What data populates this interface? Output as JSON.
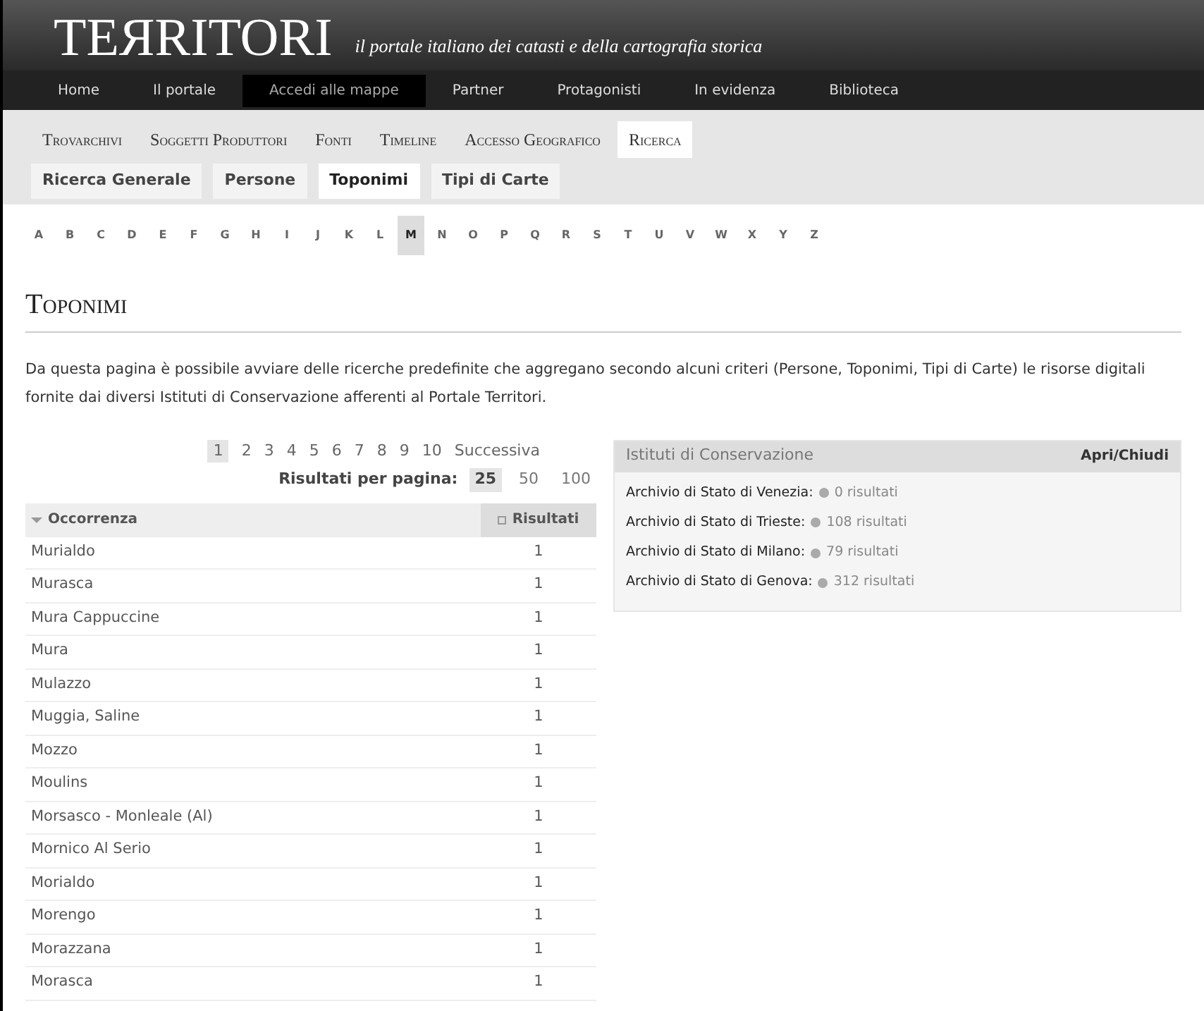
{
  "header": {
    "logo": "TEЯRITORI",
    "tagline": "il portale italiano dei catasti e della cartografia storica"
  },
  "main_nav": [
    {
      "label": "Home",
      "selected": false
    },
    {
      "label": "Il portale",
      "selected": false
    },
    {
      "label": "Accedi alle mappe",
      "selected": true
    },
    {
      "label": "Partner",
      "selected": false
    },
    {
      "label": "Protagonisti",
      "selected": false
    },
    {
      "label": "In evidenza",
      "selected": false
    },
    {
      "label": "Biblioteca",
      "selected": false
    }
  ],
  "section_nav": [
    {
      "label": "Trovarchivi",
      "selected": false
    },
    {
      "label": "Soggetti Produttori",
      "selected": false
    },
    {
      "label": "Fonti",
      "selected": false
    },
    {
      "label": "Timeline",
      "selected": false
    },
    {
      "label": "Accesso Geografico",
      "selected": false
    },
    {
      "label": "Ricerca",
      "selected": true
    }
  ],
  "sub_tabs": [
    {
      "label": "Ricerca Generale",
      "selected": false
    },
    {
      "label": "Persone",
      "selected": false
    },
    {
      "label": "Toponimi",
      "selected": true
    },
    {
      "label": "Tipi di Carte",
      "selected": false
    }
  ],
  "letters": [
    {
      "label": "A",
      "selected": false
    },
    {
      "label": "B",
      "selected": false
    },
    {
      "label": "C",
      "selected": false
    },
    {
      "label": "D",
      "selected": false
    },
    {
      "label": "E",
      "selected": false
    },
    {
      "label": "F",
      "selected": false
    },
    {
      "label": "G",
      "selected": false
    },
    {
      "label": "H",
      "selected": false
    },
    {
      "label": "I",
      "selected": false
    },
    {
      "label": "J",
      "selected": false
    },
    {
      "label": "K",
      "selected": false
    },
    {
      "label": "L",
      "selected": false
    },
    {
      "label": "M",
      "selected": true
    },
    {
      "label": "N",
      "selected": false
    },
    {
      "label": "O",
      "selected": false
    },
    {
      "label": "P",
      "selected": false
    },
    {
      "label": "Q",
      "selected": false
    },
    {
      "label": "R",
      "selected": false
    },
    {
      "label": "S",
      "selected": false
    },
    {
      "label": "T",
      "selected": false
    },
    {
      "label": "U",
      "selected": false
    },
    {
      "label": "V",
      "selected": false
    },
    {
      "label": "W",
      "selected": false
    },
    {
      "label": "X",
      "selected": false
    },
    {
      "label": "Y",
      "selected": false
    },
    {
      "label": "Z",
      "selected": false
    }
  ],
  "page_title": "Toponimi",
  "intro": "Da questa pagina è possibile avviare delle ricerche predefinite che aggregano secondo alcuni criteri (Persone, Toponimi, Tipi di Carte) le risorse digitali fornite dai diversi Istituti di Conservazione afferenti al Portale Territori.",
  "pagination": {
    "pages": [
      {
        "label": "1",
        "selected": true
      },
      {
        "label": "2",
        "selected": false
      },
      {
        "label": "3",
        "selected": false
      },
      {
        "label": "4",
        "selected": false
      },
      {
        "label": "5",
        "selected": false
      },
      {
        "label": "6",
        "selected": false
      },
      {
        "label": "7",
        "selected": false
      },
      {
        "label": "8",
        "selected": false
      },
      {
        "label": "9",
        "selected": false
      },
      {
        "label": "10",
        "selected": false
      }
    ],
    "next": "Successiva",
    "per_page_label": "Risultati per pagina:",
    "per_page": [
      {
        "label": "25",
        "selected": true
      },
      {
        "label": "50",
        "selected": false
      },
      {
        "label": "100",
        "selected": false
      }
    ]
  },
  "table": {
    "columns": [
      "Occorrenza",
      "Risultati"
    ],
    "rows": [
      [
        "Murialdo",
        "1"
      ],
      [
        "Murasca",
        "1"
      ],
      [
        "Mura Cappuccine",
        "1"
      ],
      [
        "Mura",
        "1"
      ],
      [
        "Mulazzo",
        "1"
      ],
      [
        "Muggia, Saline",
        "1"
      ],
      [
        "Mozzo",
        "1"
      ],
      [
        "Moulins",
        "1"
      ],
      [
        "Morsasco - Monleale (Al)",
        "1"
      ],
      [
        "Mornico Al Serio",
        "1"
      ],
      [
        "Morialdo",
        "1"
      ],
      [
        "Morengo",
        "1"
      ],
      [
        "Morazzana",
        "1"
      ],
      [
        "Morasca",
        "1"
      ]
    ]
  },
  "institutes": {
    "title": "Istituti di Conservazione",
    "toggle": "Apri/Chiudi",
    "items": [
      {
        "name": "Archivio di Stato di Venezia:",
        "count": "0 risultati"
      },
      {
        "name": "Archivio di Stato di Trieste:",
        "count": "108 risultati"
      },
      {
        "name": "Archivio di Stato di Milano:",
        "count": "79 risultati"
      },
      {
        "name": "Archivio di Stato di Genova:",
        "count": "312 risultati"
      }
    ]
  }
}
